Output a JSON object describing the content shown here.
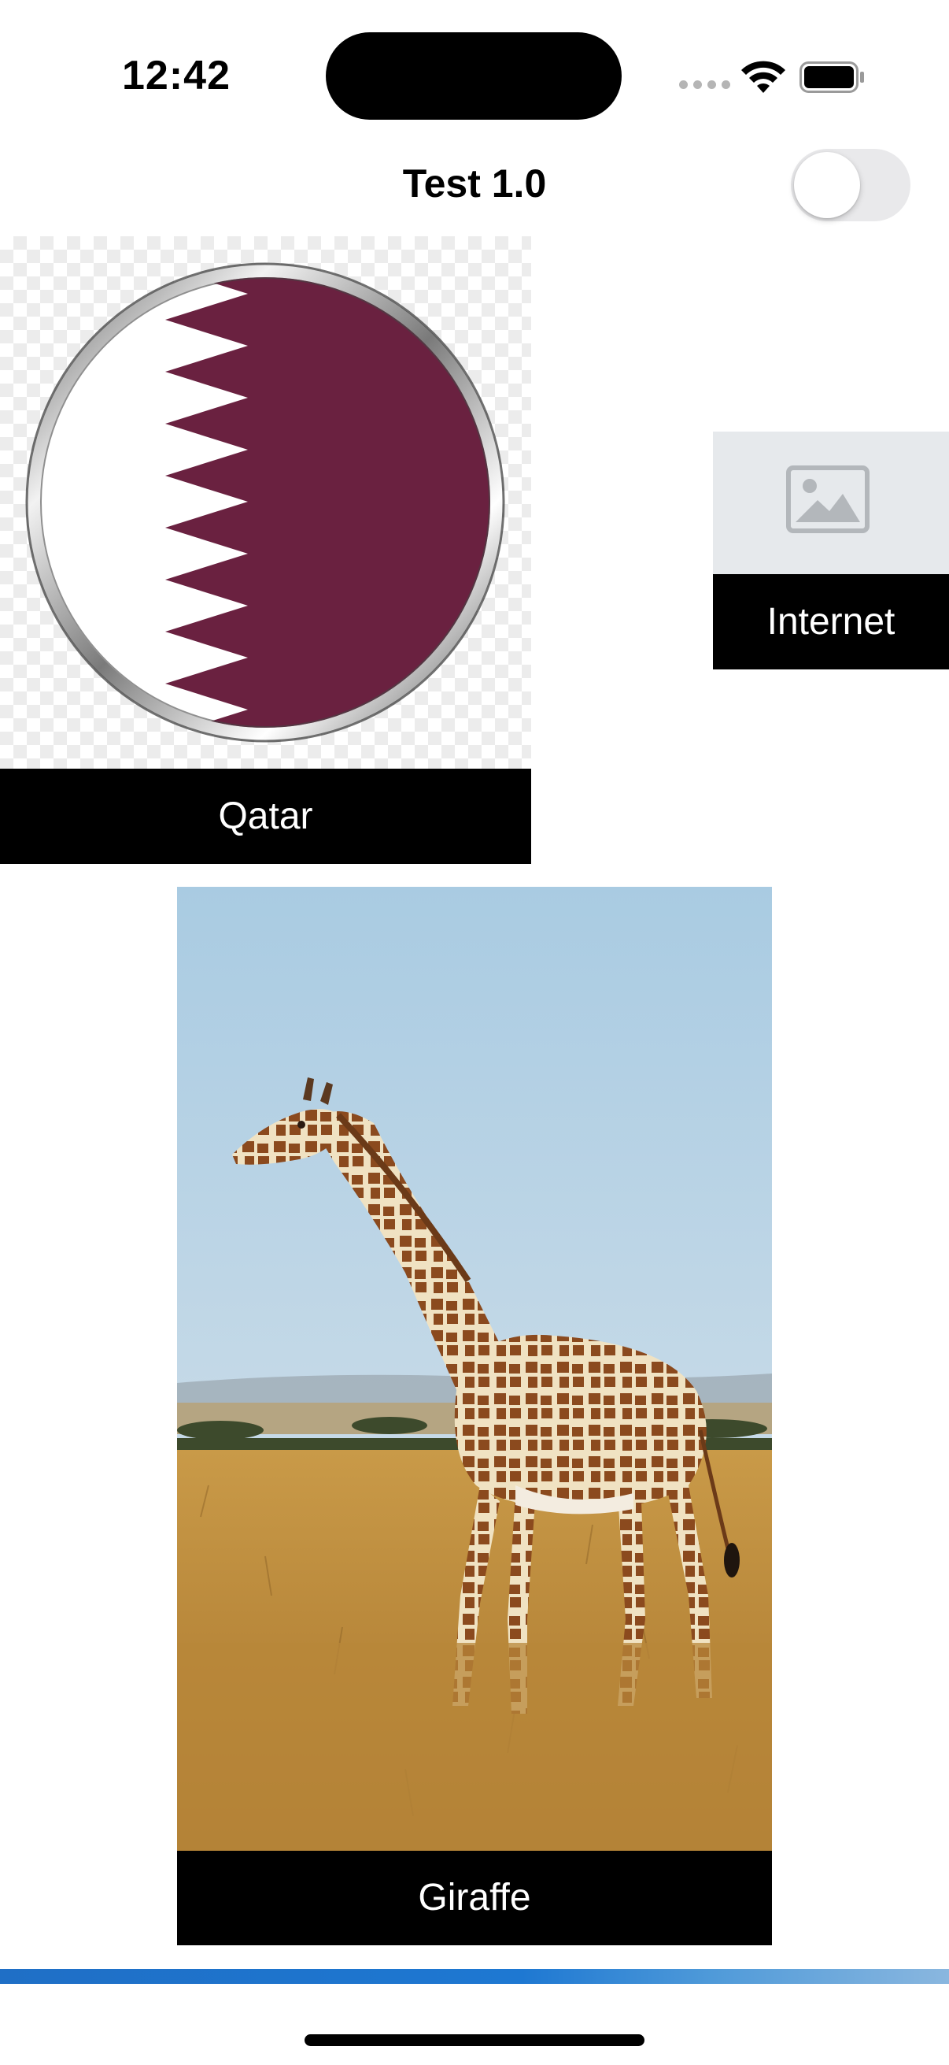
{
  "status_bar": {
    "time": "12:42",
    "icons": [
      "signal-dots-icon",
      "wifi-icon",
      "battery-icon"
    ]
  },
  "nav": {
    "title": "Test 1.0",
    "toggle_on": false
  },
  "cards": {
    "qatar": {
      "caption": "Qatar",
      "image": "qatar-flag-button-image"
    },
    "internet": {
      "caption": "Internet",
      "image": "image-placeholder-icon"
    },
    "giraffe": {
      "caption": "Giraffe",
      "image": "giraffe-photo"
    }
  },
  "colors": {
    "caption_background": "#000000",
    "caption_text": "#ffffff",
    "qatar_maroon": "#6a2140",
    "toggle_off": "#e9e9eb",
    "banner_blue": "#1e78d2"
  }
}
